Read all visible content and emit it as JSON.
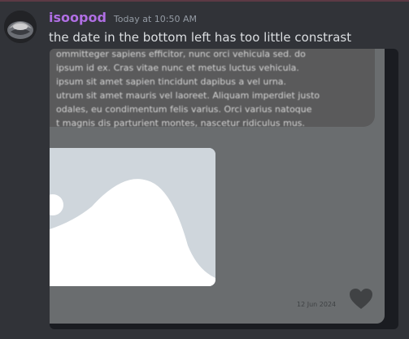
{
  "message": {
    "username": "isoopod",
    "timestamp": "Today at 10:50 AM",
    "text": "the date in the bottom left has too little constrast"
  },
  "attachment": {
    "blurred_lines": [
      "ommitteger sapiens efficitor, nunc orci vehicula sed. do",
      "ipsum id ex. Cras vitae nunc et metus luctus vehicula.",
      "ipsum sit amet sapien tincidunt dapibus a vel urna.",
      "utrum sit amet mauris vel laoreet. Aliquam imperdiet justo",
      "odales, eu condimentum felis varius. Orci varius natoque",
      "t magnis dis parturient montes, nascetur ridiculus mus."
    ],
    "date": "12 Jun 2024"
  },
  "colors": {
    "username": "#b06fe4",
    "background": "#313338",
    "text": "#dbdee1"
  }
}
